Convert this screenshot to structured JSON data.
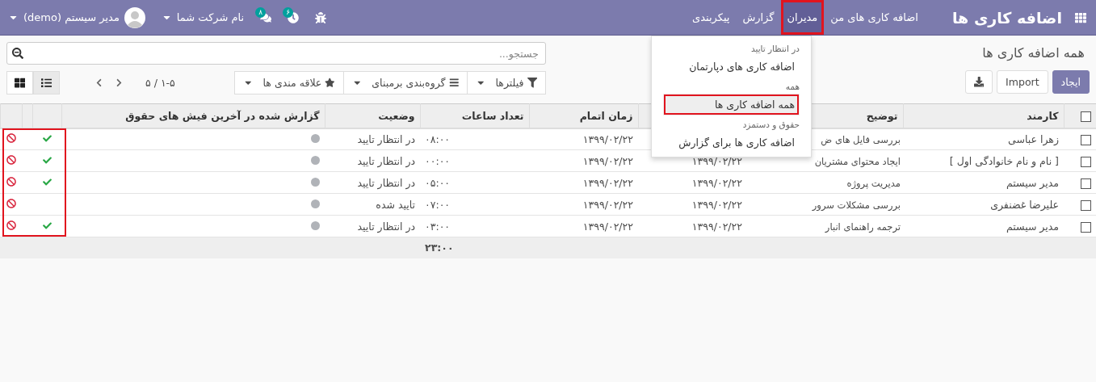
{
  "app": {
    "title": "اضافه کاری ها"
  },
  "menu": [
    {
      "label": "اضافه کاری های من",
      "selected": false,
      "framed": false
    },
    {
      "label": "مدیران",
      "selected": true,
      "framed": true
    },
    {
      "label": "گزارش",
      "selected": false,
      "framed": false
    },
    {
      "label": "پیکربندی",
      "selected": false,
      "framed": false
    }
  ],
  "systray": {
    "activity_count": "۶",
    "message_count": "۸",
    "company": "نام شرکت شما",
    "user": "مدیر سیستم (demo)"
  },
  "breadcrumb": "همه اضافه کاری ها",
  "buttons": {
    "create": "ایجاد",
    "import": "Import"
  },
  "search": {
    "placeholder": "جستجو..."
  },
  "search_options": [
    {
      "kind": "filter",
      "label": "فیلترها"
    },
    {
      "kind": "group",
      "label": "گروه‌بندی برمبنای"
    },
    {
      "kind": "favorite",
      "label": "علاقه مندی ها"
    }
  ],
  "pager": "۱-۵ / ۵",
  "views": [
    {
      "kind": "list",
      "selected": true
    },
    {
      "kind": "kanban",
      "selected": false
    }
  ],
  "dropdown": [
    {
      "kind": "header",
      "label": "در انتظار تایید"
    },
    {
      "kind": "item",
      "label": "اضافه کاری های دپارتمان",
      "highlighted": false,
      "framed": false
    },
    {
      "kind": "header",
      "label": "همه"
    },
    {
      "kind": "item",
      "label": "همه اضافه کاری ها",
      "highlighted": true,
      "framed": true
    },
    {
      "kind": "header",
      "label": "حقوق و دستمزد"
    },
    {
      "kind": "item",
      "label": "اضافه کاری ها برای گزارش",
      "highlighted": false,
      "framed": false
    }
  ],
  "table": {
    "all_checked": false,
    "columns": {
      "employee": "کارمند",
      "description": "توضیح",
      "end": "زمان اتمام",
      "hours": "تعداد ساعات",
      "status": "وضعیت",
      "payslip": "گزارش شده در آخرین فیش های حقوق"
    },
    "rows": [
      {
        "checked": false,
        "employee": "زهرا عباسی",
        "description": "بررسی فایل های ض",
        "end": "۱۳۹۹/۰۲/۲۲",
        "hours": "۰۸:۰۰",
        "status": "در انتظار تایید",
        "in_payslip": false,
        "approvable": true
      },
      {
        "checked": false,
        "employee": "[ نام و نام خانوادگی اول ]",
        "description": "ایجاد محتوای مشتریان",
        "column_3": "۱۳۹۹/۰۲/۲۲",
        "end": "۱۳۹۹/۰۲/۲۲",
        "hours": "۰۰:۰۰",
        "status": "در انتظار تایید",
        "in_payslip": false,
        "approvable": true
      },
      {
        "checked": false,
        "employee": "مدیر سیستم",
        "description": "مدیریت پروژه",
        "column_3": "۱۳۹۹/۰۲/۲۲",
        "end": "۱۳۹۹/۰۲/۲۲",
        "hours": "۰۵:۰۰",
        "status": "در انتظار تایید",
        "in_payslip": false,
        "approvable": true
      },
      {
        "checked": false,
        "employee": "علیرضا غضنفری",
        "description": "بررسی مشکلات سرور",
        "column_3": "۱۳۹۹/۰۲/۲۲",
        "end": "۱۳۹۹/۰۲/۲۲",
        "hours": "۰۷:۰۰",
        "status": "تایید شده",
        "in_payslip": false,
        "approvable": false
      },
      {
        "checked": false,
        "employee": "مدیر سیستم",
        "description": "ترجمه راهنمای انبار",
        "column_3": "۱۳۹۹/۰۲/۲۲",
        "end": "۱۳۹۹/۰۲/۲۲",
        "hours": "۰۳:۰۰",
        "status": "در انتظار تایید",
        "in_payslip": false,
        "approvable": true
      }
    ],
    "total_hours": "۲۳:۰۰",
    "icon_columns_framed": true
  }
}
